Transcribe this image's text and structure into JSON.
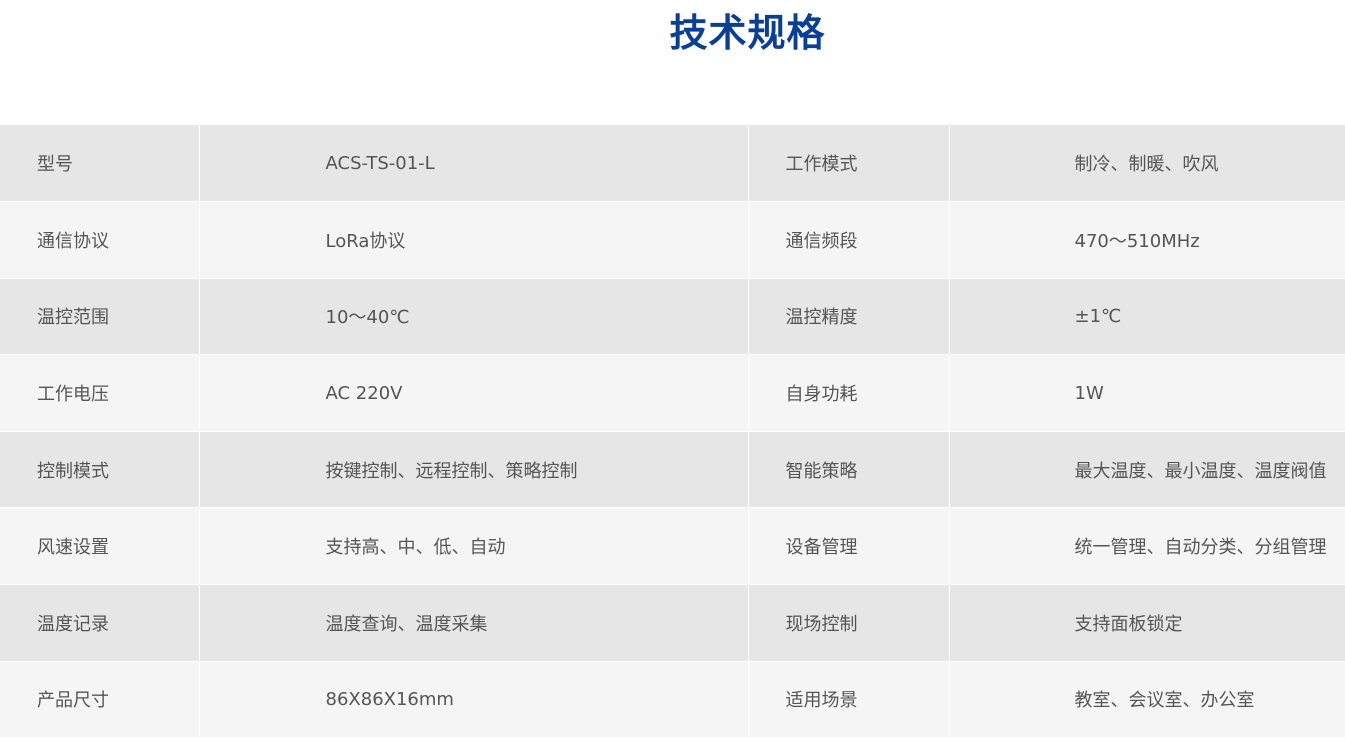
{
  "title": "技术规格",
  "rows": [
    {
      "label1": "型号",
      "value1": "ACS-TS-01-L",
      "label2": "工作模式",
      "value2": "制冷、制暖、吹风"
    },
    {
      "label1": "通信协议",
      "value1": "LoRa协议",
      "label2": "通信频段",
      "value2": "470～510MHz"
    },
    {
      "label1": "温控范围",
      "value1": "10～40℃",
      "label2": "温控精度",
      "value2": "±1℃"
    },
    {
      "label1": "工作电压",
      "value1": "AC 220V",
      "label2": "自身功耗",
      "value2": "1W"
    },
    {
      "label1": "控制模式",
      "value1": "按键控制、远程控制、策略控制",
      "label2": "智能策略",
      "value2": "最大温度、最小温度、温度阀值"
    },
    {
      "label1": "风速设置",
      "value1": "支持高、中、低、自动",
      "label2": "设备管理",
      "value2": "统一管理、自动分类、分组管理"
    },
    {
      "label1": "温度记录",
      "value1": "温度查询、温度采集",
      "label2": "现场控制",
      "value2": "支持面板锁定"
    },
    {
      "label1": "产品尺寸",
      "value1": "86X86X16mm",
      "label2": "适用场景",
      "value2": "教室、会议室、办公室"
    }
  ],
  "colors": {
    "title": "#0b3f94",
    "row_odd": "#e6e6e6",
    "row_even": "#f5f5f5",
    "text": "#555555"
  }
}
